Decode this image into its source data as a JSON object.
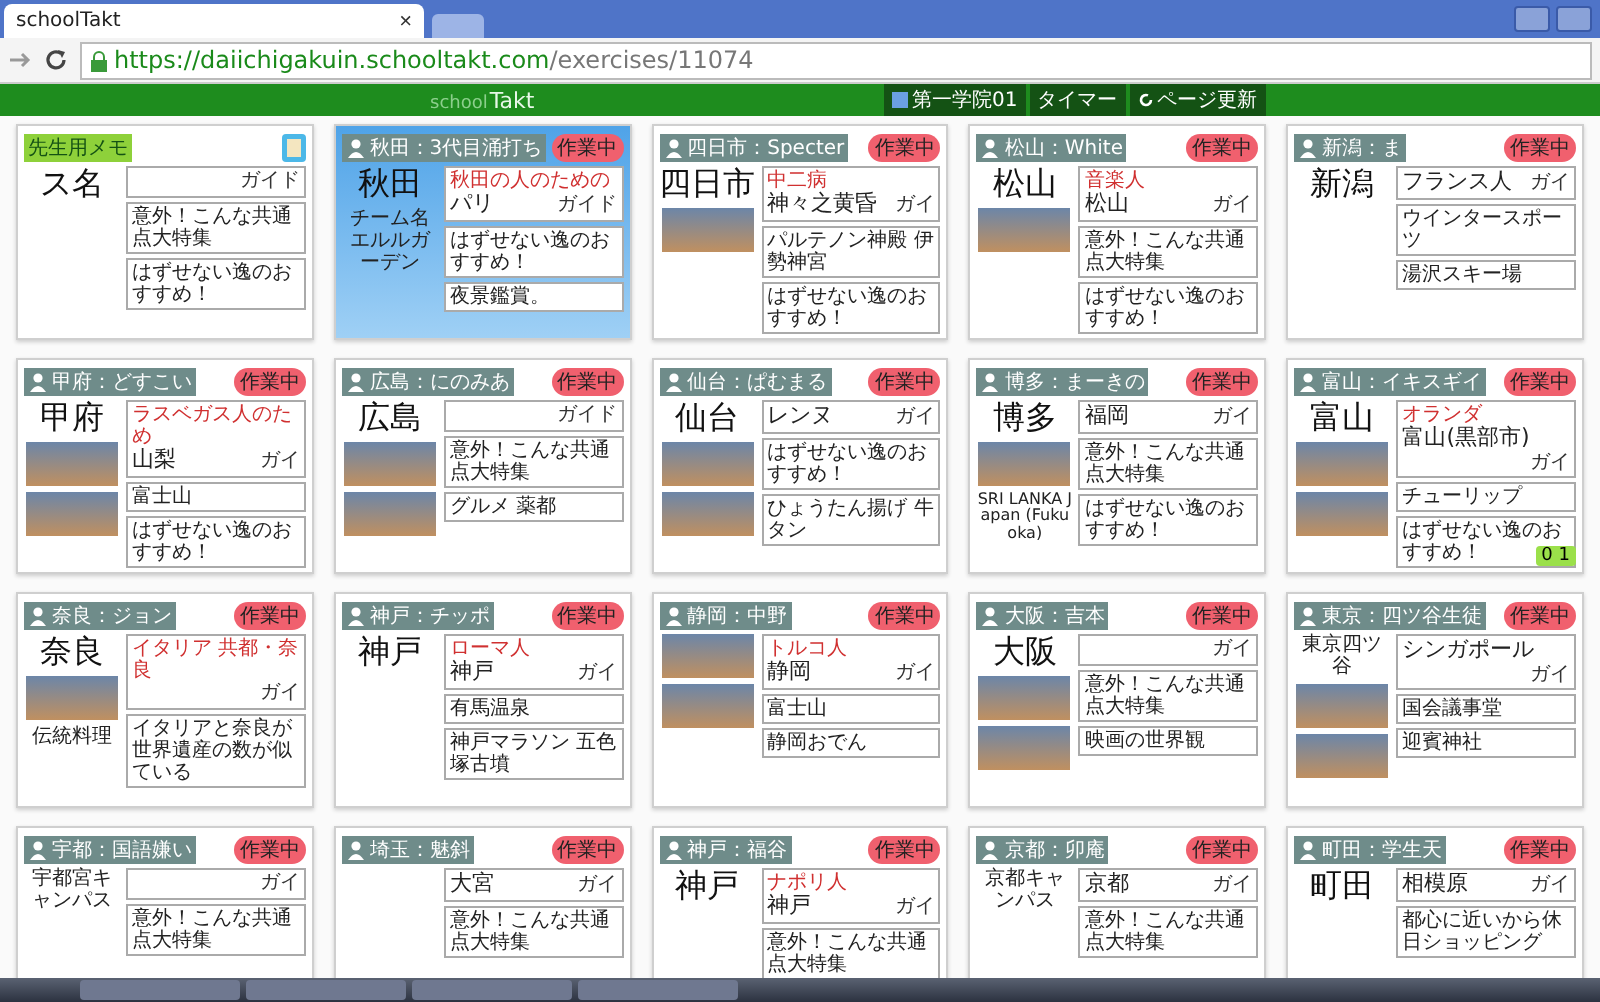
{
  "browser": {
    "tab_title": "schoolTakt",
    "tab_close": "×",
    "url_host": "https://daiichigakuin.schooltakt.com",
    "url_path": "/exercises/11074"
  },
  "toolbar": {
    "logo_left": "school",
    "logo_right": "Takt",
    "buttons": [
      {
        "label": "第一学院01",
        "kind": "menu"
      },
      {
        "label": "タイマー",
        "kind": "plain"
      },
      {
        "label": "ページ更新",
        "kind": "reload"
      }
    ]
  },
  "cards": [
    {
      "kind": "memo",
      "tag": "先生用メモ",
      "backdrop": false,
      "guide": "ガイド",
      "left": [
        {
          "kind": "city",
          "text": "ス名"
        }
      ],
      "notes": [
        "意外！こんな共通点大特集",
        "はずせない逸のおすすめ！"
      ]
    },
    {
      "kind": "student",
      "tag": "秋田：3代目涌打ち",
      "status": "作業中",
      "backdrop": true,
      "subtitle": "秋田の人のための",
      "title": "パリ",
      "guide": "ガイド",
      "left": [
        {
          "kind": "city",
          "text": "秋田"
        },
        {
          "kind": "text",
          "text": "チーム名エルルガーデン"
        }
      ],
      "notes": [
        "はずせない逸のおすすめ！",
        "夜景鑑賞。"
      ]
    },
    {
      "kind": "student",
      "tag": "四日市：Specter",
      "status": "作業中",
      "backdrop": false,
      "subtitle": "中二病",
      "title": "神々之黄昏",
      "guide": "ガイ",
      "left": [
        {
          "kind": "city",
          "text": "四日市"
        },
        {
          "kind": "photo"
        }
      ],
      "notes": [
        "パルテノン神殿 伊勢神宮",
        "はずせない逸のおすすめ！"
      ]
    },
    {
      "kind": "student",
      "tag": "松山：White",
      "status": "作業中",
      "backdrop": false,
      "subtitle": "音楽人",
      "title": "松山",
      "guide": "ガイ",
      "left": [
        {
          "kind": "city",
          "text": "松山"
        },
        {
          "kind": "photo"
        }
      ],
      "notes": [
        "意外！こんな共通点大特集",
        "はずせない逸のおすすめ！"
      ]
    },
    {
      "kind": "student",
      "tag": "新潟：ま",
      "status": "作業中",
      "backdrop": false,
      "title": "フランス人",
      "guide": "ガイ",
      "left": [
        {
          "kind": "city",
          "text": "新潟"
        }
      ],
      "notes": [
        "ウインタースポーツ",
        "湯沢スキー場"
      ]
    },
    {
      "kind": "student",
      "tag": "甲府：どすこい",
      "status": "作業中",
      "backdrop": false,
      "subtitle": "ラスベガス人のため",
      "title": "山梨",
      "guide": "ガイ",
      "left": [
        {
          "kind": "city",
          "text": "甲府"
        },
        {
          "kind": "photo"
        },
        {
          "kind": "photo"
        }
      ],
      "notes": [
        "富士山",
        "はずせない逸のおすすめ！"
      ]
    },
    {
      "kind": "student",
      "tag": "広島：にのみあ",
      "status": "作業中",
      "backdrop": false,
      "guide": "ガイド",
      "left": [
        {
          "kind": "city",
          "text": "広島"
        },
        {
          "kind": "photo"
        },
        {
          "kind": "photo"
        }
      ],
      "notes": [
        "意外！こんな共通点大特集",
        "グルメ 薬都"
      ]
    },
    {
      "kind": "student",
      "tag": "仙台：ぱむまる",
      "status": "作業中",
      "backdrop": false,
      "title": "レンヌ",
      "guide": "ガイ",
      "left": [
        {
          "kind": "city",
          "text": "仙台"
        },
        {
          "kind": "photo"
        },
        {
          "kind": "photo"
        }
      ],
      "notes": [
        "はずせない逸のおすすめ！",
        "ひょうたん揚げ 牛タン"
      ]
    },
    {
      "kind": "student",
      "tag": "博多：まーきの",
      "status": "作業中",
      "backdrop": false,
      "title": "福岡",
      "guide": "ガイ",
      "left": [
        {
          "kind": "city",
          "text": "博多"
        },
        {
          "kind": "photo"
        },
        {
          "kind": "text",
          "text": "SRI LANKA Japan (Fukuoka)"
        }
      ],
      "notes": [
        "意外！こんな共通点大特集",
        "はずせない逸のおすすめ！"
      ]
    },
    {
      "kind": "student",
      "tag": "富山：イキスギイ",
      "status": "作業中",
      "backdrop": false,
      "subtitle": "オランダ",
      "title": "富山(黒部市)",
      "guide": "ガイ",
      "left": [
        {
          "kind": "city",
          "text": "富山"
        },
        {
          "kind": "photo"
        },
        {
          "kind": "photo"
        }
      ],
      "notes": [
        "チューリップ",
        "はずせない逸のおすすめ！"
      ],
      "reaction": "0 1"
    },
    {
      "kind": "student",
      "tag": "奈良：ジョン",
      "status": "作業中",
      "backdrop": false,
      "subtitle": "イタリア 共都・奈良",
      "guide": "ガイ",
      "left": [
        {
          "kind": "city",
          "text": "奈良"
        },
        {
          "kind": "photo"
        },
        {
          "kind": "text",
          "text": "伝統料理"
        }
      ],
      "notes": [
        "イタリアと奈良が世界遺産の数が似ている"
      ]
    },
    {
      "kind": "student",
      "tag": "神戸：チッポ",
      "status": "作業中",
      "backdrop": false,
      "subtitle": "ローマ人",
      "title": "神戸",
      "guide": "ガイ",
      "left": [
        {
          "kind": "city",
          "text": "神戸"
        }
      ],
      "notes": [
        "有馬温泉",
        "神戸マラソン 五色塚古墳"
      ]
    },
    {
      "kind": "student",
      "tag": "静岡：中野",
      "status": "作業中",
      "backdrop": false,
      "subtitle": "トルコ人",
      "title": "静岡",
      "guide": "ガイ",
      "left": [
        {
          "kind": "photo"
        },
        {
          "kind": "photo"
        }
      ],
      "notes": [
        "富士山",
        "静岡おでん"
      ]
    },
    {
      "kind": "student",
      "tag": "大阪：吉本",
      "status": "作業中",
      "backdrop": false,
      "guide": "ガイ",
      "left": [
        {
          "kind": "city",
          "text": "大阪"
        },
        {
          "kind": "photo"
        },
        {
          "kind": "photo"
        }
      ],
      "notes": [
        "意外！こんな共通点大特集",
        "映画の世界観"
      ]
    },
    {
      "kind": "student",
      "tag": "東京：四ツ谷生徒",
      "status": "作業中",
      "backdrop": false,
      "title": "シンガポール",
      "guide": "ガイ",
      "left": [
        {
          "kind": "text",
          "text": "東京四ツ谷"
        },
        {
          "kind": "photo"
        },
        {
          "kind": "photo"
        }
      ],
      "notes": [
        "国会議事堂",
        "迎賓神社"
      ]
    },
    {
      "kind": "student",
      "tag": "宇都：国語嫌い",
      "status": "作業中",
      "backdrop": false,
      "guide": "ガイ",
      "left": [
        {
          "kind": "text",
          "text": "宇都宮キャンパス"
        }
      ],
      "notes": [
        "意外！こんな共通点大特集"
      ]
    },
    {
      "kind": "student",
      "tag": "埼玉：魅斜",
      "status": "作業中",
      "backdrop": false,
      "title": "大宮",
      "guide": "ガイ",
      "notes": [
        "意外！こんな共通点大特集"
      ]
    },
    {
      "kind": "student",
      "tag": "神戸：福谷",
      "status": "作業中",
      "backdrop": false,
      "subtitle": "ナポリ人",
      "title": "神戸",
      "guide": "ガイ",
      "left": [
        {
          "kind": "city",
          "text": "神戸"
        }
      ],
      "notes": [
        "意外！こんな共通点大特集"
      ]
    },
    {
      "kind": "student",
      "tag": "京都：卯庵",
      "status": "作業中",
      "backdrop": false,
      "title": "京都",
      "guide": "ガイ",
      "left": [
        {
          "kind": "text",
          "text": "京都キャンパス"
        }
      ],
      "notes": [
        "意外！こんな共通点大特集"
      ]
    },
    {
      "kind": "student",
      "tag": "町田：学生天",
      "status": "作業中",
      "backdrop": false,
      "title": "相模原",
      "guide": "ガイ",
      "left": [
        {
          "kind": "city",
          "text": "町田"
        }
      ],
      "notes": [
        "都心に近いから休日ショッピング"
      ]
    }
  ]
}
